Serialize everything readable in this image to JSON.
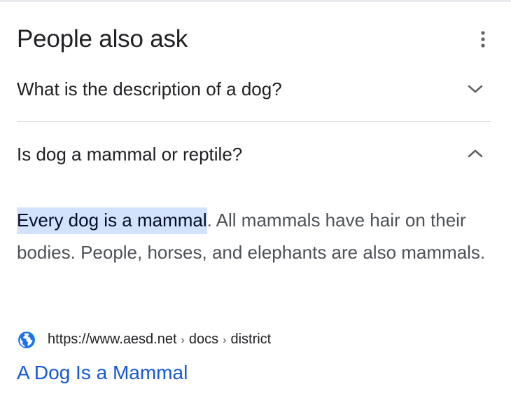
{
  "section": {
    "title": "People also ask",
    "more_icon": "more-vert-icon"
  },
  "questions": [
    {
      "text": "What is the description of a dog?",
      "expanded": false,
      "icon": "chevron-down-icon"
    },
    {
      "text": "Is dog a mammal or reptile?",
      "expanded": true,
      "icon": "chevron-up-icon"
    }
  ],
  "answer": {
    "highlight": "Every dog is a mammal",
    "rest": ". All mammals have hair on their bodies. People, horses, and elephants are also mammals."
  },
  "source": {
    "icon": "globe-icon",
    "url": "https://www.aesd.net",
    "path": [
      "docs",
      "district"
    ],
    "separator": "›",
    "link_title": "A Dog Is a Mammal"
  },
  "colors": {
    "text": "#202124",
    "secondary_text": "#4d5156",
    "highlight_bg": "#d3e3fd",
    "link": "#1558d6",
    "globe": "#1a73e8",
    "divider": "#dadce0"
  }
}
